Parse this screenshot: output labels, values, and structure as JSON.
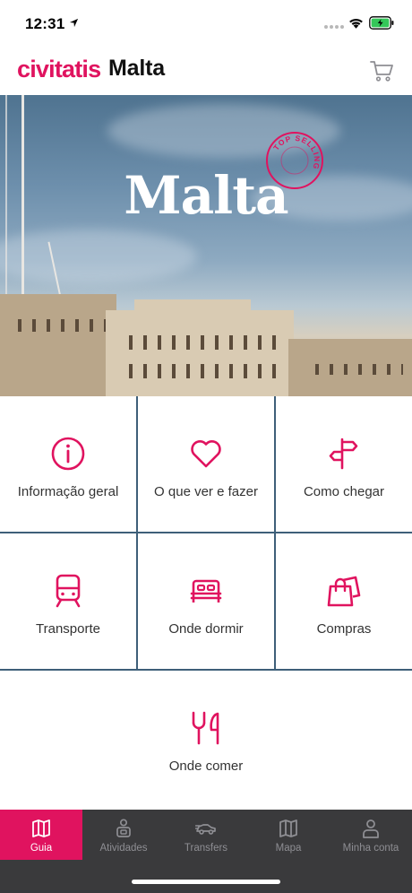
{
  "status_bar": {
    "time": "12:31"
  },
  "header": {
    "logo": "civitatis",
    "title": "Malta"
  },
  "hero": {
    "title": "Malta",
    "stamp_text": "TOP SELLING"
  },
  "grid": {
    "tiles": [
      {
        "label": "Informação geral",
        "icon": "info-icon"
      },
      {
        "label": "O que ver e fazer",
        "icon": "heart-icon"
      },
      {
        "label": "Como chegar",
        "icon": "signpost-icon"
      },
      {
        "label": "Transporte",
        "icon": "train-icon"
      },
      {
        "label": "Onde dormir",
        "icon": "bed-icon"
      },
      {
        "label": "Compras",
        "icon": "shopping-bags-icon"
      },
      {
        "label": "Onde comer",
        "icon": "fork-knife-icon"
      }
    ]
  },
  "bottom_nav": {
    "items": [
      {
        "label": "Guia",
        "icon": "map-icon",
        "active": true
      },
      {
        "label": "Atividades",
        "icon": "person-activity-icon",
        "active": false
      },
      {
        "label": "Transfers",
        "icon": "car-icon",
        "active": false
      },
      {
        "label": "Mapa",
        "icon": "map-icon",
        "active": false
      },
      {
        "label": "Minha conta",
        "icon": "user-icon",
        "active": false
      }
    ]
  },
  "colors": {
    "accent": "#e0135f",
    "nav_background": "#3a3a3c",
    "nav_inactive": "#8e8e93"
  }
}
